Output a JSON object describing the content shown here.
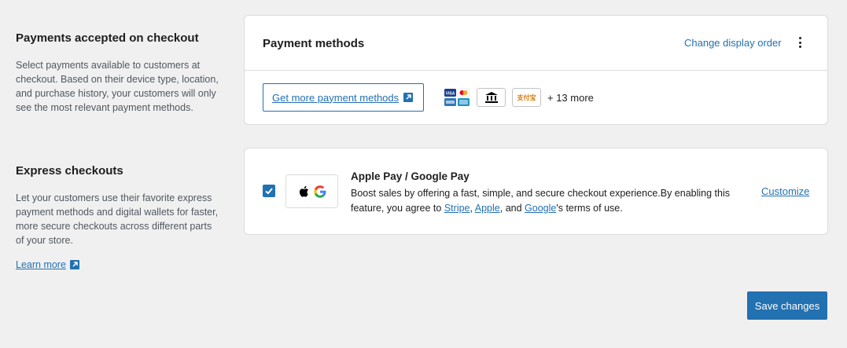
{
  "payments_section": {
    "title": "Payments accepted on checkout",
    "description": "Select payments available to customers at checkout. Based on their device type, location, and purchase history, your customers will only see the most relevant payment methods."
  },
  "express_section": {
    "title": "Express checkouts",
    "description": "Let your customers use their favorite express payment methods and digital wallets for faster, more secure checkouts across different parts of your store.",
    "learn_more": "Learn more"
  },
  "payment_methods_card": {
    "title": "Payment methods",
    "change_order": "Change display order",
    "get_more": "Get more payment methods",
    "more_count": "+ 13 more",
    "icons": [
      "cards-icon",
      "bank-icon",
      "alipay-icon"
    ]
  },
  "express_card": {
    "title": "Apple Pay / Google Pay",
    "desc_prefix": "Boost sales by offering a fast, simple, and secure checkout experience.By enabling this feature, you agree to ",
    "link_stripe": "Stripe",
    "sep1": ", ",
    "link_apple": "Apple",
    "sep2": ", and ",
    "link_google": "Google",
    "desc_suffix": "'s terms of use.",
    "customize": "Customize",
    "alipay_label": "支付宝",
    "enabled": true
  },
  "save_button": "Save changes",
  "colors": {
    "accent": "#2271b1",
    "background": "#f0f0f1",
    "border": "#dcdcde"
  }
}
